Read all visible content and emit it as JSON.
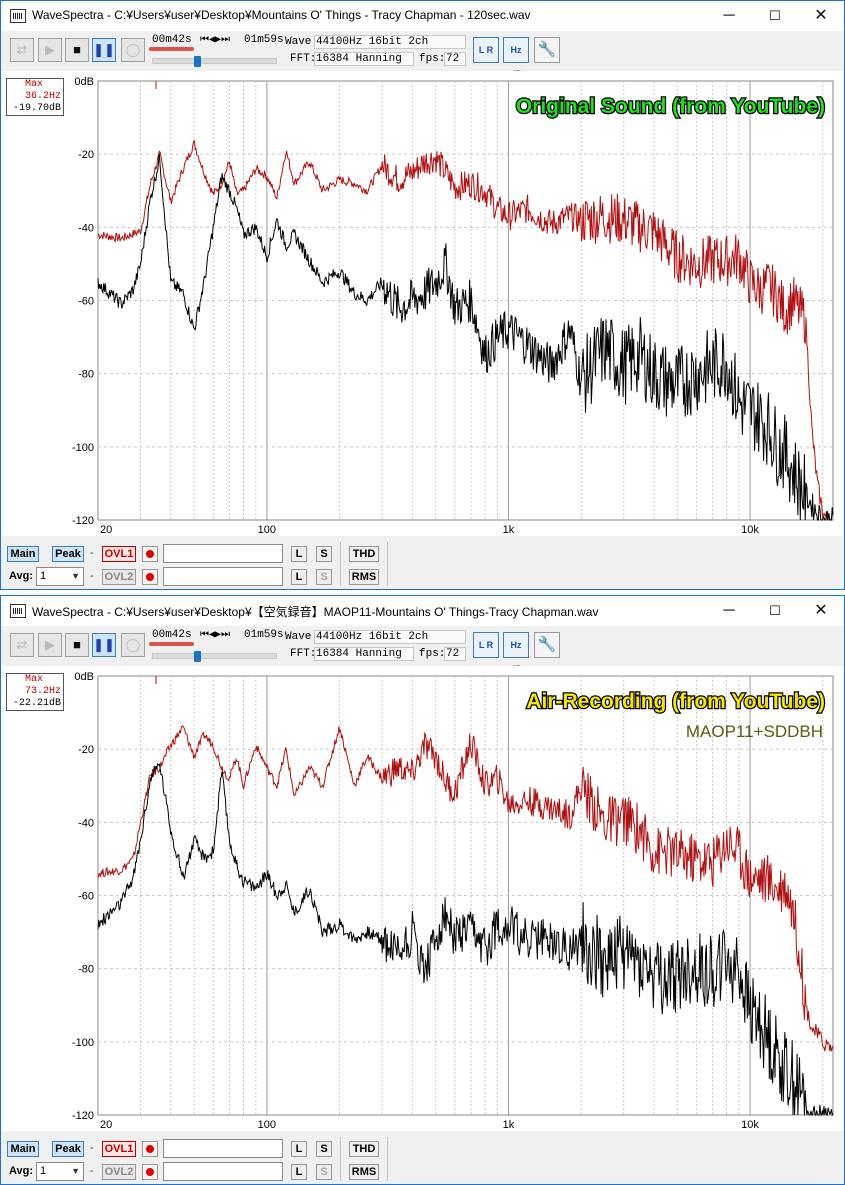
{
  "windows": [
    {
      "title": "WaveSpectra - C:¥Users¥user¥Desktop¥Mountains O' Things - Tracy Chapman - 120sec.wav",
      "toolbar": {
        "time_current": "00m42s",
        "time_total": "01m59s",
        "wave_label": "Wave:",
        "wave_value": "44100Hz 16bit 2ch",
        "fft_label": "FFT:",
        "fft_value": "16384 Hanning",
        "fps_label": "fps:",
        "fps_value": "72"
      },
      "max_box": {
        "title": "Max",
        "freq": "36.2Hz",
        "level": "-19.70dB"
      },
      "chart_data": {
        "type": "line",
        "overlay_title": "Original Sound (from YouTube)",
        "overlay_title_color": "#22dd22",
        "overlay_subtitle": "",
        "xscale": "log",
        "xlim": [
          20,
          22050
        ],
        "ylim": [
          -120,
          0
        ],
        "xticks": [
          "20",
          "100",
          "1k",
          "10k"
        ],
        "yticks": [
          "0dB",
          "-20",
          "-40",
          "-60",
          "-80",
          "-100",
          "-120"
        ],
        "grid": true,
        "series": [
          {
            "color": "#b01010",
            "x": [
              20,
              25,
              30,
              33,
              36,
              40,
              45,
              50,
              55,
              60,
              65,
              70,
              75,
              80,
              90,
              100,
              110,
              120,
              130,
              150,
              170,
              200,
              230,
              260,
              300,
              350,
              400,
              450,
              500,
              550,
              600,
              700,
              800,
              900,
              1000,
              1200,
              1500,
              1800,
              2000,
              2500,
              3000,
              3500,
              4000,
              4500,
              5000,
              6000,
              7000,
              8000,
              9000,
              10000,
              11000,
              12000,
              13000,
              14000,
              15000,
              16000,
              17000,
              18000,
              19000,
              20000,
              21000,
              22050
            ],
            "y": [
              -42,
              -43,
              -41,
              -28,
              -20,
              -33,
              -24,
              -17,
              -25,
              -31,
              -28,
              -22,
              -31,
              -30,
              -24,
              -26,
              -32,
              -19,
              -28,
              -22,
              -30,
              -27,
              -28,
              -30,
              -23,
              -27,
              -25,
              -22,
              -21,
              -25,
              -29,
              -28,
              -30,
              -35,
              -37,
              -35,
              -39,
              -37,
              -38,
              -37,
              -38,
              -40,
              -41,
              -45,
              -48,
              -50,
              -49,
              -49,
              -48,
              -55,
              -57,
              -56,
              -59,
              -63,
              -60,
              -63,
              -65,
              -95,
              -110,
              -118,
              -120,
              -120
            ]
          },
          {
            "color": "#000000",
            "x": [
              20,
              25,
              28,
              30,
              33,
              36,
              40,
              45,
              50,
              55,
              60,
              65,
              70,
              75,
              80,
              90,
              100,
              110,
              120,
              130,
              150,
              170,
              200,
              230,
              260,
              300,
              350,
              400,
              450,
              500,
              550,
              600,
              700,
              800,
              900,
              1000,
              1200,
              1500,
              1800,
              2000,
              2500,
              3000,
              3500,
              4000,
              4500,
              5000,
              6000,
              7000,
              8000,
              9000,
              10000,
              11000,
              12000,
              13000,
              14000,
              15000,
              16000,
              17000,
              18000,
              19000,
              20000,
              22050
            ],
            "y": [
              -55,
              -61,
              -57,
              -50,
              -32,
              -21,
              -55,
              -58,
              -68,
              -55,
              -40,
              -26,
              -30,
              -35,
              -42,
              -40,
              -48,
              -38,
              -45,
              -42,
              -49,
              -55,
              -52,
              -58,
              -60,
              -55,
              -62,
              -60,
              -58,
              -55,
              -50,
              -62,
              -60,
              -75,
              -70,
              -68,
              -72,
              -78,
              -68,
              -82,
              -73,
              -78,
              -75,
              -80,
              -82,
              -83,
              -80,
              -78,
              -76,
              -88,
              -90,
              -92,
              -95,
              -100,
              -102,
              -106,
              -110,
              -113,
              -116,
              -118,
              -120,
              -120
            ]
          }
        ]
      },
      "bottom": {
        "main": "Main",
        "peak": "Peak",
        "ovl1": "OVL1",
        "ovl2": "OVL2",
        "avg_label": "Avg:",
        "avg_value": "1",
        "l": "L",
        "s": "S",
        "thd": "THD",
        "rms": "RMS"
      }
    },
    {
      "title": "WaveSpectra - C:¥Users¥user¥Desktop¥【空気録音】MAOP11-Mountains O' Things-Tracy Chapman.wav",
      "toolbar": {
        "time_current": "00m42s",
        "time_total": "01m59s",
        "wave_label": "Wave:",
        "wave_value": "44100Hz 16bit 2ch",
        "fft_label": "FFT:",
        "fft_value": "16384 Hanning",
        "fps_label": "fps:",
        "fps_value": "72"
      },
      "max_box": {
        "title": "Max",
        "freq": "73.2Hz",
        "level": "-22.21dB"
      },
      "chart_data": {
        "type": "line",
        "overlay_title": "Air-Recording (from YouTube)",
        "overlay_title_color": "#f5e600",
        "overlay_subtitle": "MAOP11+SDDBH",
        "xscale": "log",
        "xlim": [
          20,
          22050
        ],
        "ylim": [
          -120,
          0
        ],
        "xticks": [
          "20",
          "100",
          "1k",
          "10k"
        ],
        "yticks": [
          "0dB",
          "-20",
          "-40",
          "-60",
          "-80",
          "-100",
          "-120"
        ],
        "grid": true,
        "series": [
          {
            "color": "#b01010",
            "x": [
              20,
              25,
              28,
              30,
              33,
              36,
              40,
              45,
              50,
              55,
              60,
              65,
              70,
              75,
              80,
              90,
              100,
              110,
              120,
              130,
              150,
              170,
              200,
              230,
              260,
              300,
              350,
              400,
              450,
              500,
              550,
              600,
              700,
              800,
              900,
              1000,
              1200,
              1500,
              1800,
              2000,
              2500,
              3000,
              3500,
              4000,
              4500,
              5000,
              6000,
              7000,
              8000,
              9000,
              10000,
              11000,
              12000,
              13000,
              14000,
              15000,
              16000,
              17000,
              18000,
              20000,
              22050
            ],
            "y": [
              -54,
              -53,
              -50,
              -40,
              -27,
              -25,
              -19,
              -14,
              -22,
              -16,
              -19,
              -25,
              -28,
              -22,
              -30,
              -19,
              -25,
              -30,
              -20,
              -33,
              -25,
              -30,
              -14,
              -30,
              -22,
              -28,
              -25,
              -27,
              -19,
              -22,
              -29,
              -32,
              -18,
              -30,
              -28,
              -35,
              -34,
              -36,
              -38,
              -30,
              -40,
              -39,
              -42,
              -48,
              -48,
              -49,
              -50,
              -51,
              -45,
              -48,
              -55,
              -55,
              -56,
              -58,
              -57,
              -63,
              -75,
              -90,
              -96,
              -100,
              -102
            ]
          },
          {
            "color": "#000000",
            "x": [
              20,
              25,
              28,
              30,
              33,
              36,
              40,
              45,
              50,
              55,
              60,
              65,
              70,
              75,
              80,
              90,
              100,
              110,
              120,
              130,
              150,
              170,
              200,
              230,
              260,
              300,
              350,
              400,
              450,
              500,
              550,
              600,
              700,
              800,
              900,
              1000,
              1200,
              1500,
              1800,
              2000,
              2500,
              3000,
              3500,
              4000,
              4500,
              5000,
              6000,
              7000,
              8000,
              9000,
              10000,
              11000,
              12000,
              13000,
              14000,
              15000,
              16000,
              17000,
              18000,
              20000,
              22050
            ],
            "y": [
              -68,
              -62,
              -55,
              -45,
              -28,
              -24,
              -42,
              -55,
              -45,
              -50,
              -48,
              -26,
              -45,
              -52,
              -56,
              -58,
              -54,
              -60,
              -57,
              -65,
              -58,
              -70,
              -68,
              -72,
              -70,
              -72,
              -75,
              -70,
              -80,
              -72,
              -65,
              -72,
              -70,
              -75,
              -68,
              -68,
              -72,
              -72,
              -75,
              -72,
              -78,
              -75,
              -78,
              -82,
              -84,
              -82,
              -80,
              -81,
              -78,
              -80,
              -92,
              -95,
              -100,
              -104,
              -108,
              -110,
              -114,
              -117,
              -120,
              -120,
              -120
            ]
          }
        ]
      },
      "bottom": {
        "main": "Main",
        "peak": "Peak",
        "ovl1": "OVL1",
        "ovl2": "OVL2",
        "avg_label": "Avg:",
        "avg_value": "1",
        "l": "L",
        "s": "S",
        "thd": "THD",
        "rms": "RMS"
      }
    }
  ]
}
